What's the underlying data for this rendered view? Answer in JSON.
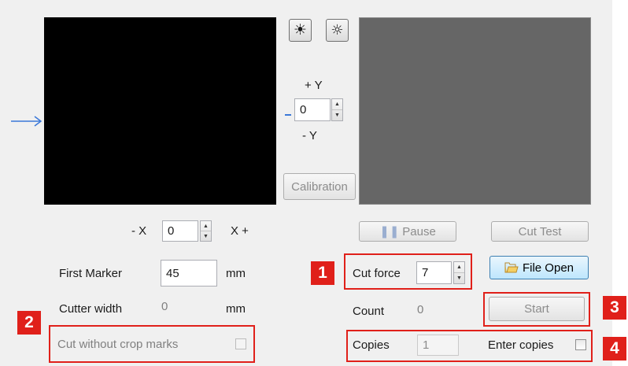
{
  "brightness": {
    "high_icon": "sun-filled-icon",
    "low_icon": "sun-dotted-icon"
  },
  "y_offset": {
    "plus_label": "+ Y",
    "minus_label": "- Y",
    "value": "0"
  },
  "x_offset": {
    "minus_label": "- X",
    "plus_label": "X +",
    "value": "0"
  },
  "calibration_label": "Calibration",
  "pause_label": "Pause",
  "cut_test_label": "Cut Test",
  "first_marker": {
    "label": "First Marker",
    "value": "45",
    "unit": "mm"
  },
  "cutter_width": {
    "label": "Cutter width",
    "value": "0",
    "unit": "mm"
  },
  "cut_without_crop_marks_label": "Cut without crop marks",
  "cut_force": {
    "label": "Cut force",
    "value": "7"
  },
  "file_open_label": "File Open",
  "count": {
    "label": "Count",
    "value": "0"
  },
  "start_label": "Start",
  "copies": {
    "label": "Copies",
    "value": "1"
  },
  "enter_copies_label": "Enter copies",
  "callouts": {
    "n1": "1",
    "n2": "2",
    "n3": "3",
    "n4": "4"
  },
  "colors": {
    "callout_red": "#e0201a",
    "arrow_blue": "#3b78d8"
  }
}
